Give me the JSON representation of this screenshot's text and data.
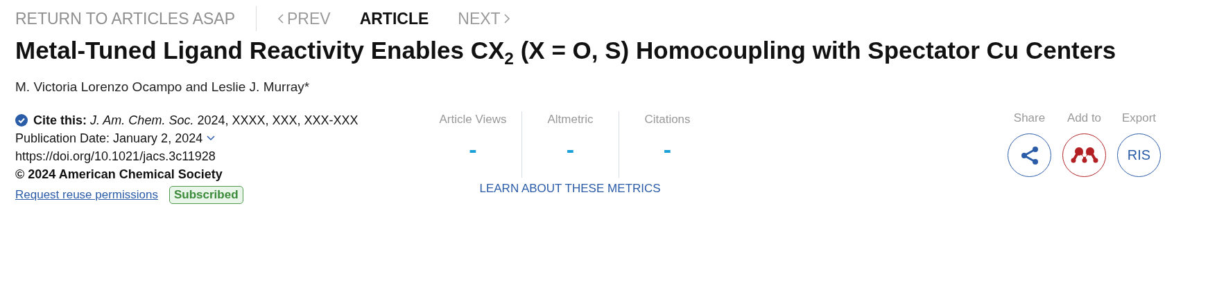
{
  "nav": {
    "back": "RETURN TO ARTICLES ASAP",
    "items": [
      {
        "kind": "prev",
        "label": "PREV",
        "selected": false
      },
      {
        "kind": "plain",
        "label": "ARTICLE",
        "selected": true
      },
      {
        "kind": "next",
        "label": "NEXT",
        "selected": false
      }
    ]
  },
  "title": "Metal-Tuned Ligand Reactivity Enables CX$_{2}$ (X = O, S) Homocoupling with Spectator Cu Centers",
  "authors": "M. Victoria Lorenzo Ocampo and Leslie J. Murray*",
  "citation": {
    "cite": "**Cite this:** *J. Am. Chem. Soc.*  2024, XXXX, XXX, XXX-XXX",
    "publication_date": "Publication Date: January 2, 2024",
    "doi": "https://doi.org/10.1021/jacs.3c11928",
    "copyright": "© 2024 American Chemical Society",
    "reuse_link": "Request reuse permissions",
    "badge": "Subscribed"
  },
  "metrics": {
    "items": [
      {
        "label": "Article Views",
        "value": "-"
      },
      {
        "label": "Altmetric",
        "value": "-"
      },
      {
        "label": "Citations",
        "value": "-"
      }
    ],
    "link": "LEARN ABOUT THESE METRICS"
  },
  "actions": [
    {
      "kind": "share",
      "label": "Share"
    },
    {
      "kind": "addto",
      "label": "Add to"
    },
    {
      "kind": "export",
      "label": "Export",
      "button_text": "RIS"
    }
  ]
}
